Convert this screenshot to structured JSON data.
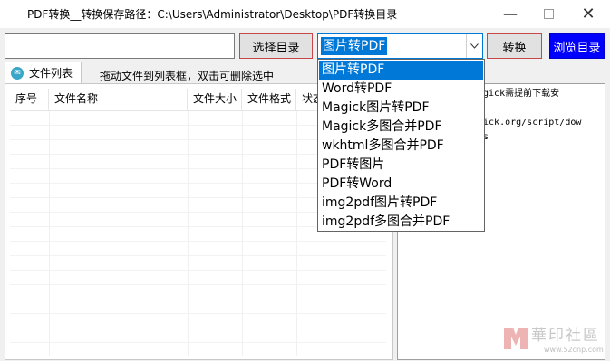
{
  "window": {
    "title": "PDF转换__转换保存路径：C:\\Users\\Administrator\\Desktop\\PDF转换目录"
  },
  "toolbar": {
    "path_value": "",
    "select_dir_label": "选择目录",
    "mode_selected": "图片转PDF",
    "convert_label": "转换",
    "browse_label": "浏览目录"
  },
  "mode_options": [
    "图片转PDF",
    "Word转PDF",
    "Magick图片转PDF",
    "Magick多图合并PDF",
    "wkhtml多图合并PDF",
    "PDF转图片",
    "PDF转Word",
    "img2pdf图片转PDF",
    "img2pdf多图合并PDF"
  ],
  "tab": {
    "label": "文件列表"
  },
  "hint": "拖动文件到列表框，双击可删除选中",
  "file_table": {
    "columns": [
      "序号",
      "文件名称",
      "文件大小",
      "文件格式",
      "状态"
    ],
    "rows": []
  },
  "log": {
    "text": "agick需提前下载安\n\ngick.org/script/dow\nws"
  },
  "watermark": {
    "text": "華印社區",
    "url": "www.52cnp.com"
  },
  "colors": {
    "accent": "#0078d7",
    "browse_button": "#0000ff",
    "focus_border": "#c9464b"
  }
}
